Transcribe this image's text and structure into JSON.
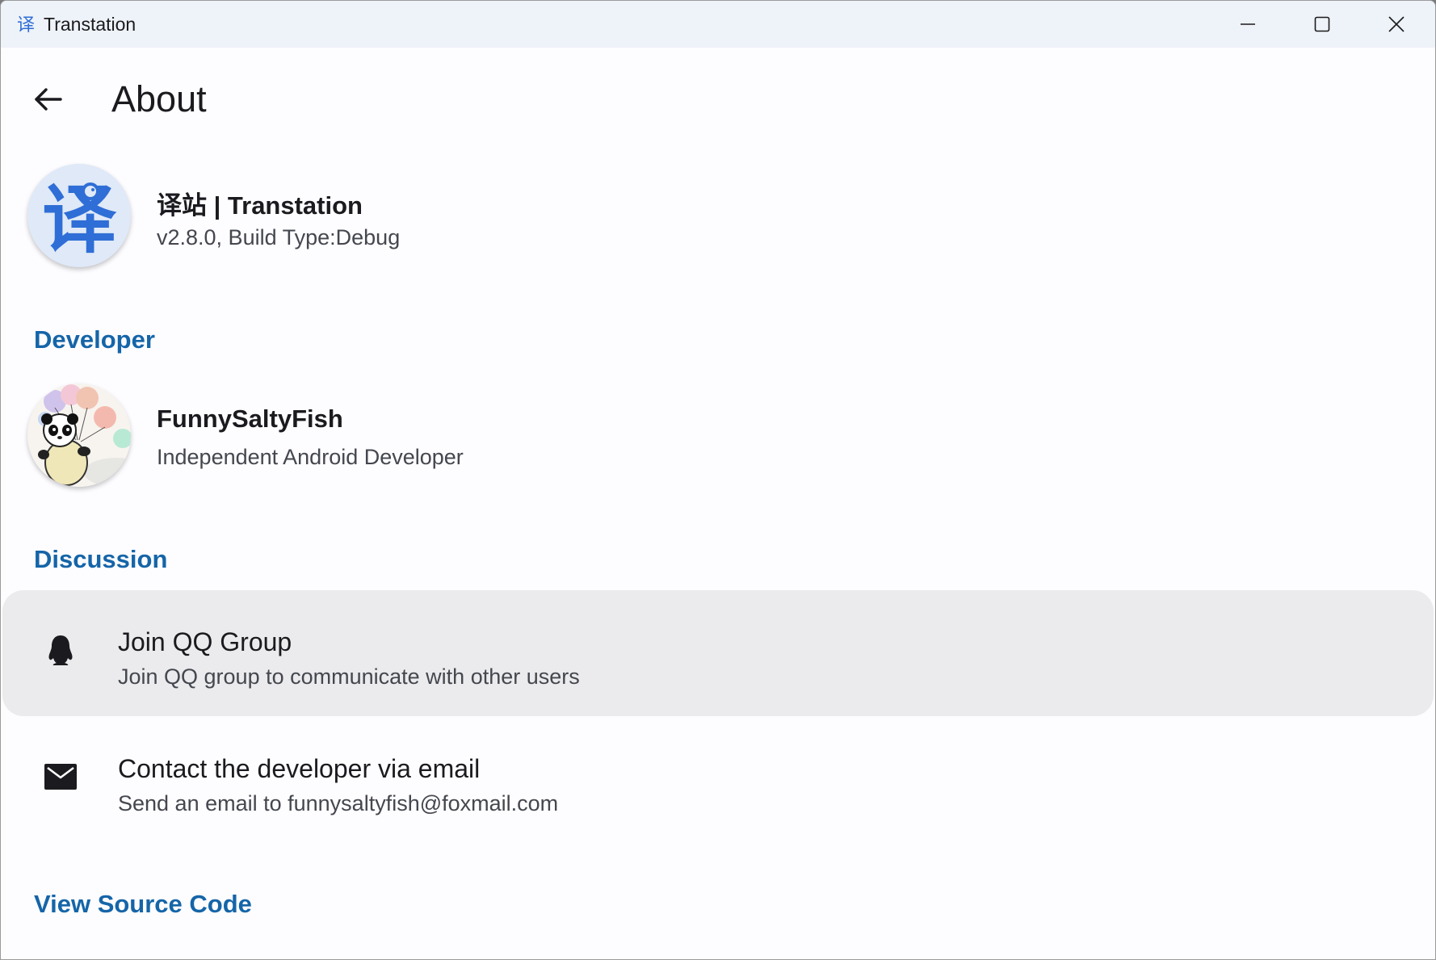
{
  "window": {
    "title": "Transtation"
  },
  "header": {
    "title": "About"
  },
  "app_info": {
    "name": "译站 | Transtation",
    "version": "v2.8.0, Build Type:Debug",
    "logo_char": "译"
  },
  "developer_section": {
    "title": "Developer",
    "name": "FunnySaltyFish",
    "description": "Independent Android Developer"
  },
  "discussion_section": {
    "title": "Discussion",
    "items": [
      {
        "title": "Join QQ Group",
        "subtitle": "Join QQ group to communicate with other users",
        "icon": "qq-penguin-icon"
      },
      {
        "title": "Contact the developer via email",
        "subtitle": "Send an email to funnysaltyfish@foxmail.com",
        "icon": "email-icon"
      }
    ]
  },
  "source_section": {
    "title": "View Source Code"
  },
  "colors": {
    "accent": "#1565a8",
    "window_bg": "#fdfcff",
    "titlebar_bg": "#eef2f9",
    "highlight_bg": "#ebebed",
    "logo_blue": "#2f6ed6"
  }
}
